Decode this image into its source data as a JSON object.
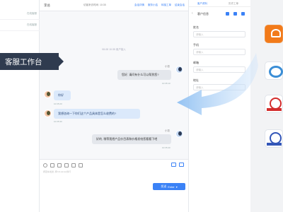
{
  "overlay": {
    "label": "客服工作台"
  },
  "sessions": {
    "rows": [
      {
        "time": "在线客服"
      },
      {
        "time": "在线客服"
      }
    ]
  },
  "chat": {
    "header": {
      "customer": "李总",
      "meta": "访客来访时间: 10:35",
      "links": [
        "会话详情",
        "服务小结",
        "转接工单",
        "结束会话"
      ]
    },
    "system_message": "08-08 10:35 用户接入",
    "messages": [
      {
        "from": "agent",
        "name": "小张",
        "text": "您好, 请问有什么可以帮到您?",
        "time": "10:35:10"
      },
      {
        "from": "customer",
        "text": "你好",
        "time": "10:35:20"
      },
      {
        "from": "customer",
        "text": "我想咨询一下你们这个产品具体是怎么收费的?",
        "time": "10:35:30"
      },
      {
        "from": "agent",
        "name": "小张",
        "text": "好的, 稍等我把产品价目表和价格发给您看看下吧",
        "time": "10:35:40"
      }
    ],
    "composer_hint": "按回车发送, 按Ctrl+Enter换行",
    "send_button": {
      "label": "发送",
      "shortcut": "Enter",
      "dropdown_icon": "chevron-down-icon"
    }
  },
  "customer_panel": {
    "tabs": [
      "客户资料",
      "历史工单"
    ],
    "title": "客户信息",
    "fields": [
      {
        "label": "姓名",
        "placeholder": "请输入"
      },
      {
        "label": "手机",
        "placeholder": "请输入"
      },
      {
        "label": "邮箱",
        "placeholder": "请输入"
      },
      {
        "label": "地址",
        "placeholder": "请输入"
      }
    ]
  },
  "apps": [
    "orange-app-icon",
    "qq-app-icon",
    "red-app-icon",
    "blue-red-app-icon"
  ],
  "colors": {
    "accent": "#3b82f6",
    "overlay_bg": "#2f3b4f"
  }
}
